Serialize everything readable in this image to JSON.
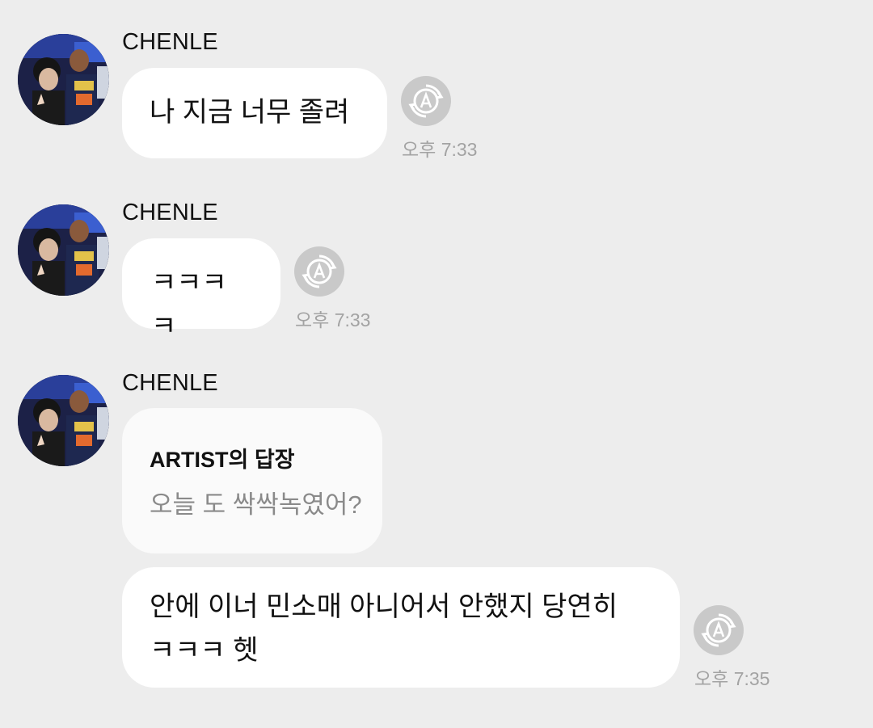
{
  "messages": [
    {
      "sender": "CHENLE",
      "text": "나 지금 너무 졸려",
      "time": "오후 7:33"
    },
    {
      "sender": "CHENLE",
      "text": "ㅋㅋㅋㅋ",
      "time": "오후 7:33"
    },
    {
      "sender": "CHENLE",
      "reply_to": {
        "title": "ARTIST의 답장",
        "text": "오늘 도 싹싹녹였어?"
      },
      "text_lines": [
        "안에 이너 민소매 아니어서 안했지 당연히",
        "ㅋㅋㅋ 헷"
      ],
      "time": "오후 7:35"
    }
  ],
  "icons": {
    "avatar": "profile-photo",
    "translate": "auto-translate-icon"
  },
  "colors": {
    "background": "#ededed",
    "bubble": "#ffffff",
    "quote_bubble": "#fafafa",
    "translate_button": "#c9c9c9",
    "timestamp": "#a3a3a3"
  }
}
